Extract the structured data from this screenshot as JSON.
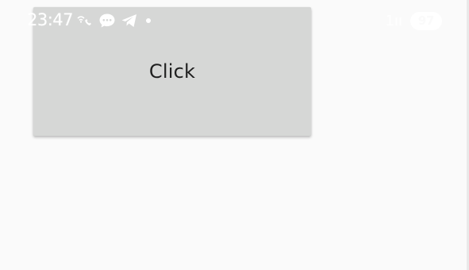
{
  "status_bar": {
    "time": "23:47",
    "notification_icons": [
      "wifi-calling-icon",
      "chat-bubble-icon",
      "telegram-icon",
      "more-dot-icon"
    ],
    "signal": "1ıı",
    "battery": "97",
    "icon_color": "#ffffff"
  },
  "app": {
    "button_label": "Click",
    "background": "#fafafa",
    "button_color": "#d6d7d6"
  }
}
